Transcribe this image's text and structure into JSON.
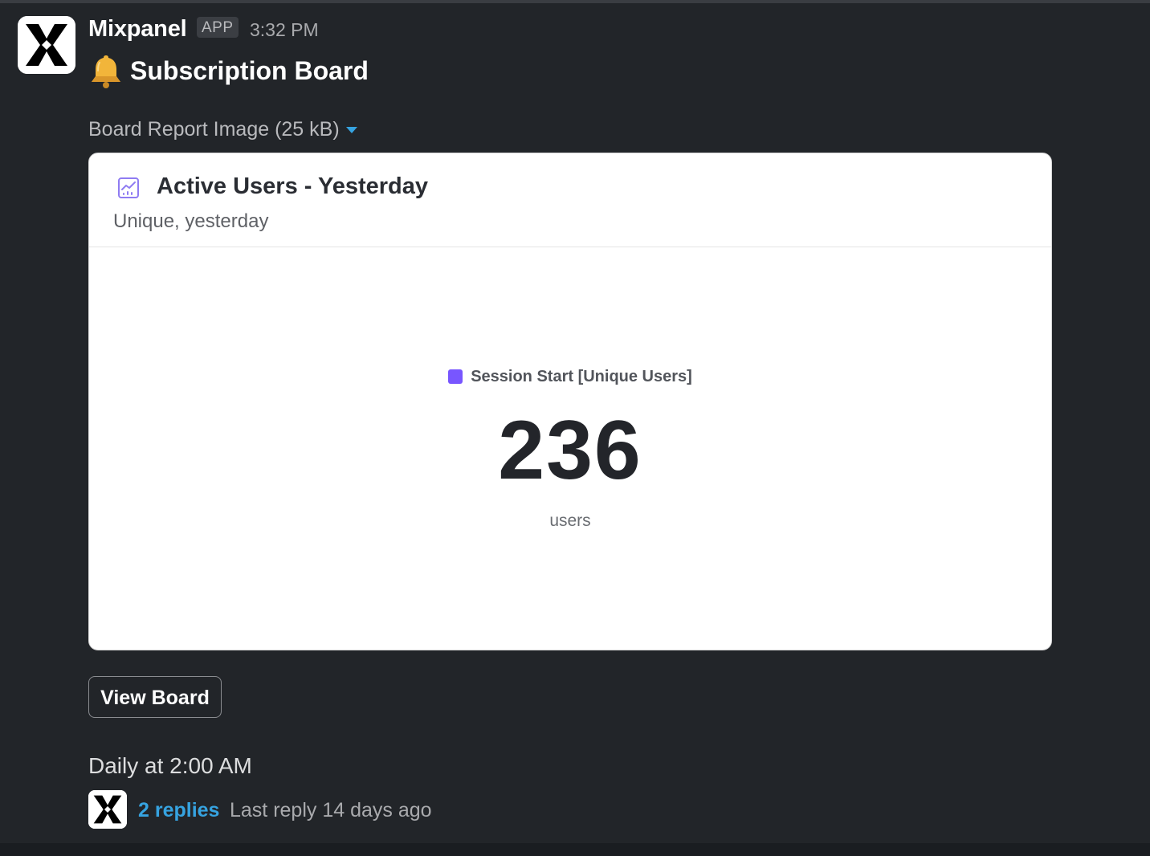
{
  "message": {
    "sender": "Mixpanel",
    "badge": "APP",
    "time": "3:32 PM",
    "title_emoji_icon": "bell-icon",
    "title": "Subscription Board"
  },
  "attachment": {
    "label": "Board Report Image (25 kB)",
    "toggle_icon": "caret-down-icon"
  },
  "card": {
    "icon": "line-chart-icon",
    "title": "Active Users - Yesterday",
    "subtitle": "Unique, yesterday",
    "legend_label": "Session Start [Unique Users]",
    "legend_color": "#7856ff",
    "value": "236",
    "unit": "users"
  },
  "actions": {
    "view_board": "View Board"
  },
  "footer": {
    "schedule": "Daily at 2:00 AM",
    "replies": "2 replies",
    "last_reply": "Last reply 14 days ago"
  },
  "colors": {
    "background": "#222529",
    "link": "#36a3e0",
    "accent": "#7856ff"
  }
}
